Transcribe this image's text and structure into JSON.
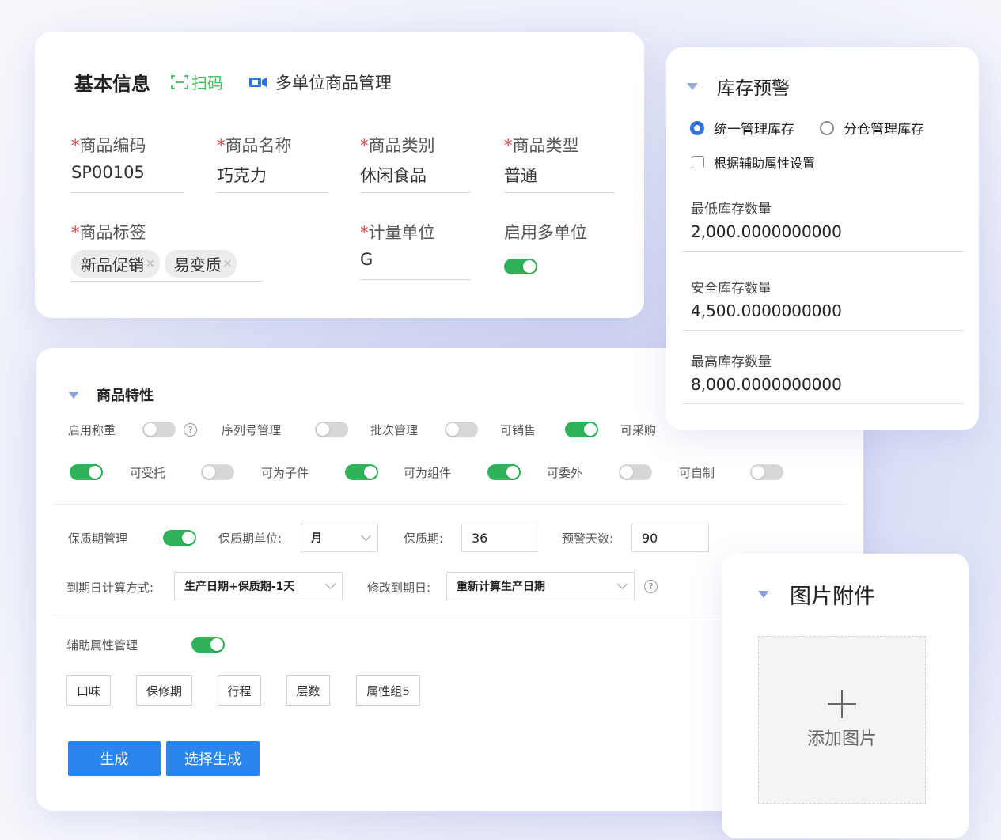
{
  "basic_info": {
    "title": "基本信息",
    "scan_label": "扫码",
    "multi_unit_label": "多单位商品管理",
    "required_mark": "*",
    "fields": {
      "code": {
        "label": "商品编码",
        "value": "SP00105"
      },
      "name": {
        "label": "商品名称",
        "value": "巧克力"
      },
      "category": {
        "label": "商品类别",
        "value": "休闲食品"
      },
      "type": {
        "label": "商品类型",
        "value": "普通"
      },
      "tags_label": "商品标签",
      "unit": {
        "label": "计量单位",
        "value": "G"
      },
      "multi_unit_enable": {
        "label": "启用多单位",
        "enabled": true
      }
    },
    "tags": [
      "新品促销",
      "易变质"
    ]
  },
  "stock_warning": {
    "title": "库存预警",
    "radio_unified": "统一管理库存",
    "radio_split": "分仓管理库存",
    "checkbox_aux": "根据辅助属性设置",
    "min": {
      "label": "最低库存数量",
      "value": "2,000.0000000000"
    },
    "safe": {
      "label": "安全库存数量",
      "value": "4,500.0000000000"
    },
    "max": {
      "label": "最高库存数量",
      "value": "8,000.0000000000"
    }
  },
  "features": {
    "title": "商品特性",
    "row1": {
      "weighing": "启用称重",
      "serial": "序列号管理",
      "batch": "批次管理",
      "sellable": "可销售",
      "purchasable": "可采购"
    },
    "row2": {
      "consign": "可受托",
      "subpart": "可为子件",
      "component": "可为组件",
      "outsource": "可委外",
      "selfmade": "可自制"
    },
    "shelf": {
      "manage": "保质期管理",
      "unit_label": "保质期单位:",
      "unit_value": "月",
      "period_label": "保质期:",
      "period_value": "36",
      "warn_label": "预警天数:",
      "warn_value": "90"
    },
    "expiry": {
      "calc_label": "到期日计算方式:",
      "calc_value": "生产日期+保质期-1天",
      "modify_label": "修改到期日:",
      "modify_value": "重新计算生产日期"
    },
    "aux_label": "辅助属性管理",
    "attrs": [
      "口味",
      "保修期",
      "行程",
      "层数",
      "属性组5"
    ],
    "generate": "生成",
    "select_generate": "选择生成"
  },
  "image_attach": {
    "title": "图片附件",
    "add_label": "添加图片"
  },
  "colors": {
    "toggle_on": "#2fb35a",
    "primary": "#2a85ee",
    "required": "#e0393e",
    "scan": "#3fbf5a"
  }
}
